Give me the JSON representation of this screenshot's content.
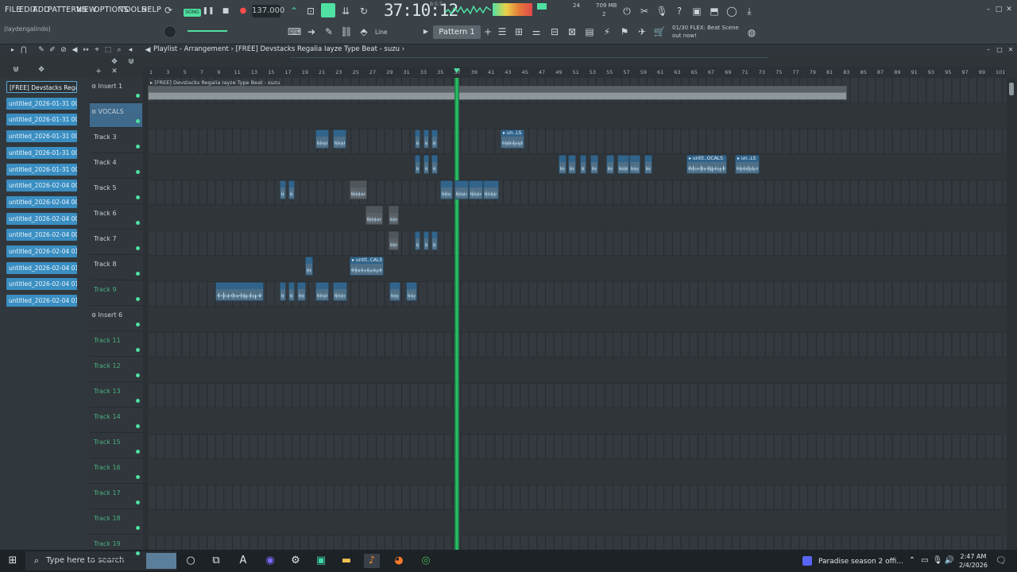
{
  "menu": {
    "items": [
      "FILE",
      "EDIT",
      "ADD",
      "PATTERNS",
      "VIEW",
      "OPTIONS",
      "TOOLS",
      "HELP"
    ]
  },
  "transport": {
    "mode_label": "SONG",
    "tempo": "137.000",
    "time": "37:10:12",
    "bst_label": "B:S:T",
    "cpu_value": "24",
    "memory": "709 MB",
    "polyphony": "2",
    "pattern": "Pattern 1",
    "snap": "Line",
    "user_hint": "(laydengalindo)"
  },
  "news": {
    "line1": "01/30  FLEX: Beat Scene",
    "line2": "out now!"
  },
  "playlist": {
    "breadcrumb": "Playlist - Arrangement › [FREE] Devstacks  Regalia  Iayze Type Beat - suzu ›",
    "ruler_ticks": [
      "1",
      "3",
      "5",
      "7",
      "9",
      "11",
      "13",
      "15",
      "17",
      "19",
      "21",
      "23",
      "25",
      "27",
      "29",
      "31",
      "33",
      "35",
      "37",
      "39",
      "41",
      "43",
      "45",
      "47",
      "49",
      "51",
      "53",
      "55",
      "57",
      "59",
      "61",
      "63",
      "65",
      "67",
      "69",
      "71",
      "73",
      "75",
      "77",
      "79",
      "81",
      "83",
      "85",
      "87",
      "89",
      "91",
      "93",
      "95",
      "97",
      "99",
      "101"
    ],
    "top_clip_label": "▸ [FREE] Devstacks  Regalia  Iayze Type Beat - suzu"
  },
  "picker": {
    "items": [
      "[FREE] Devstacks  Regalia...",
      "untitled_2026-01-31 00-...",
      "untitled_2026-01-31 00-...",
      "untitled_2026-01-31 00-...",
      "untitled_2026-01-31 00-...",
      "untitled_2026-01-31 00-...",
      "untitled_2026-02-04 00-...",
      "untitled_2026-02-04 00-...",
      "untitled_2026-02-04 00-...",
      "untitled_2026-02-04 00-...",
      "untitled_2026-02-04 01-...",
      "untitled_2026-02-04 01-...",
      "untitled_2026-02-04 01-...",
      "untitled_2026-02-04 01-..."
    ]
  },
  "tracks": [
    {
      "label": "Insert 1",
      "dim": false
    },
    {
      "label": "VOCALS",
      "dim": false
    },
    {
      "label": "Track 3",
      "dim": false
    },
    {
      "label": "Track 4",
      "dim": false
    },
    {
      "label": "Track 5",
      "dim": false
    },
    {
      "label": "Track 6",
      "dim": false
    },
    {
      "label": "Track 7",
      "dim": false
    },
    {
      "label": "Track 8",
      "dim": false
    },
    {
      "label": "Track 9",
      "dim": true
    },
    {
      "label": "Insert 6",
      "dim": false
    },
    {
      "label": "Track 11",
      "dim": true
    },
    {
      "label": "Track 12",
      "dim": true
    },
    {
      "label": "Track 13",
      "dim": true
    },
    {
      "label": "Track 14",
      "dim": true
    },
    {
      "label": "Track 15",
      "dim": true
    },
    {
      "label": "Track 16",
      "dim": true
    },
    {
      "label": "Track 17",
      "dim": true
    },
    {
      "label": "Track 18",
      "dim": true
    },
    {
      "label": "Track 19",
      "dim": true
    }
  ],
  "clip_labels": {
    "vocals_c": "▸ un..LS",
    "t3_a": "▸ untit..OCALS",
    "t3_b": "▸ un..LS",
    "t7_a": "▸ untit..CALS"
  },
  "taskbar": {
    "search_placeholder": "Type here to search",
    "media_title": "Paradise season 2 offi...",
    "time": "2:47 AM",
    "date": "2/4/2026"
  },
  "colors": {
    "accent": "#4fe0a2",
    "clip": "#4f6f86",
    "clip_header": "#31648b",
    "picker": "#3a8ec2",
    "playhead": "#2ecf6f"
  }
}
